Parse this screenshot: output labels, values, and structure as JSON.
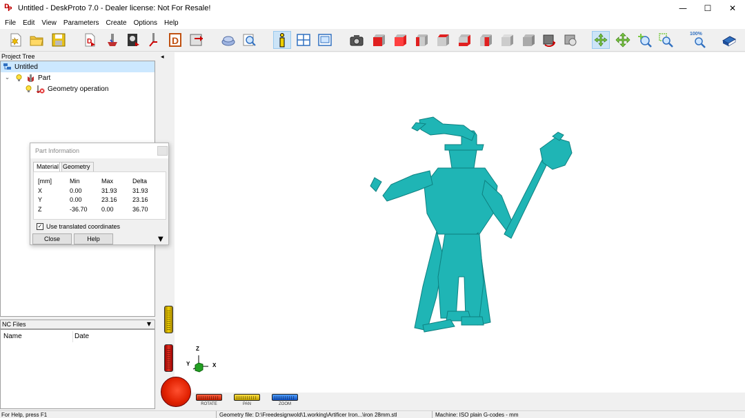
{
  "window": {
    "title": "Untitled - DeskProto 7.0 - Dealer license: Not For Resale!",
    "controls": {
      "minimize": "—",
      "maximize": "☐",
      "close": "✕"
    }
  },
  "menu": [
    "File",
    "Edit",
    "View",
    "Parameters",
    "Create",
    "Options",
    "Help"
  ],
  "toolbar": {
    "zoom_percent": "100%",
    "icons": [
      "new-file-icon",
      "open-file-icon",
      "save-file-icon",
      "import-geometry-icon",
      "part-operation-icon",
      "bitmap-icon",
      "vector-icon",
      "d-icon",
      "export-icon",
      "material-block-icon",
      "search-part-icon",
      "info-icon",
      "layout-icon",
      "screen-icon",
      "camera-icon",
      "view-cube-icons",
      "rotate-view-icon",
      "pan-view-icon",
      "zoom-in-icon",
      "zoom-window-icon",
      "zoom-100-icon",
      "book-icon"
    ]
  },
  "project_tree": {
    "header": "Project Tree",
    "items": [
      {
        "label": "Untitled",
        "level": 0
      },
      {
        "label": "Part",
        "level": 1
      },
      {
        "label": "Geometry operation",
        "level": 2
      }
    ],
    "expander": "⌄"
  },
  "nc_files": {
    "header": "NC Files",
    "columns": [
      "Name",
      "Date"
    ]
  },
  "part_information": {
    "title": "Part Information",
    "tabs": [
      "Material",
      "Geometry"
    ],
    "header_row": [
      "[mm]",
      "Min",
      "Max",
      "Delta"
    ],
    "rows": [
      [
        "X",
        "0.00",
        "31.93",
        "31.93"
      ],
      [
        "Y",
        "0.00",
        "23.16",
        "23.16"
      ],
      [
        "Z",
        "-36.70",
        "0.00",
        "36.70"
      ]
    ],
    "checkbox_label": "Use translated coordinates",
    "checkbox_checked": true,
    "check_glyph": "✓",
    "close_label": "Close",
    "help_label": "Help",
    "expand_glyph": "▼"
  },
  "viewport": {
    "collapse_glyph": "◂",
    "axis_labels": {
      "z": "Z",
      "y": "Y",
      "x": "X"
    },
    "controls": [
      "ROTATE",
      "PAN",
      "ZOOM"
    ],
    "model_color": "#1fb5b5"
  },
  "statusbar": {
    "help": "For Help, press F1",
    "geometry_file": "Geometry file: D:\\Freedesignwold\\1.working\\Artificer Iron...\\iron 28mm.stl",
    "machine": "Machine: ISO plain G-codes - mm"
  }
}
